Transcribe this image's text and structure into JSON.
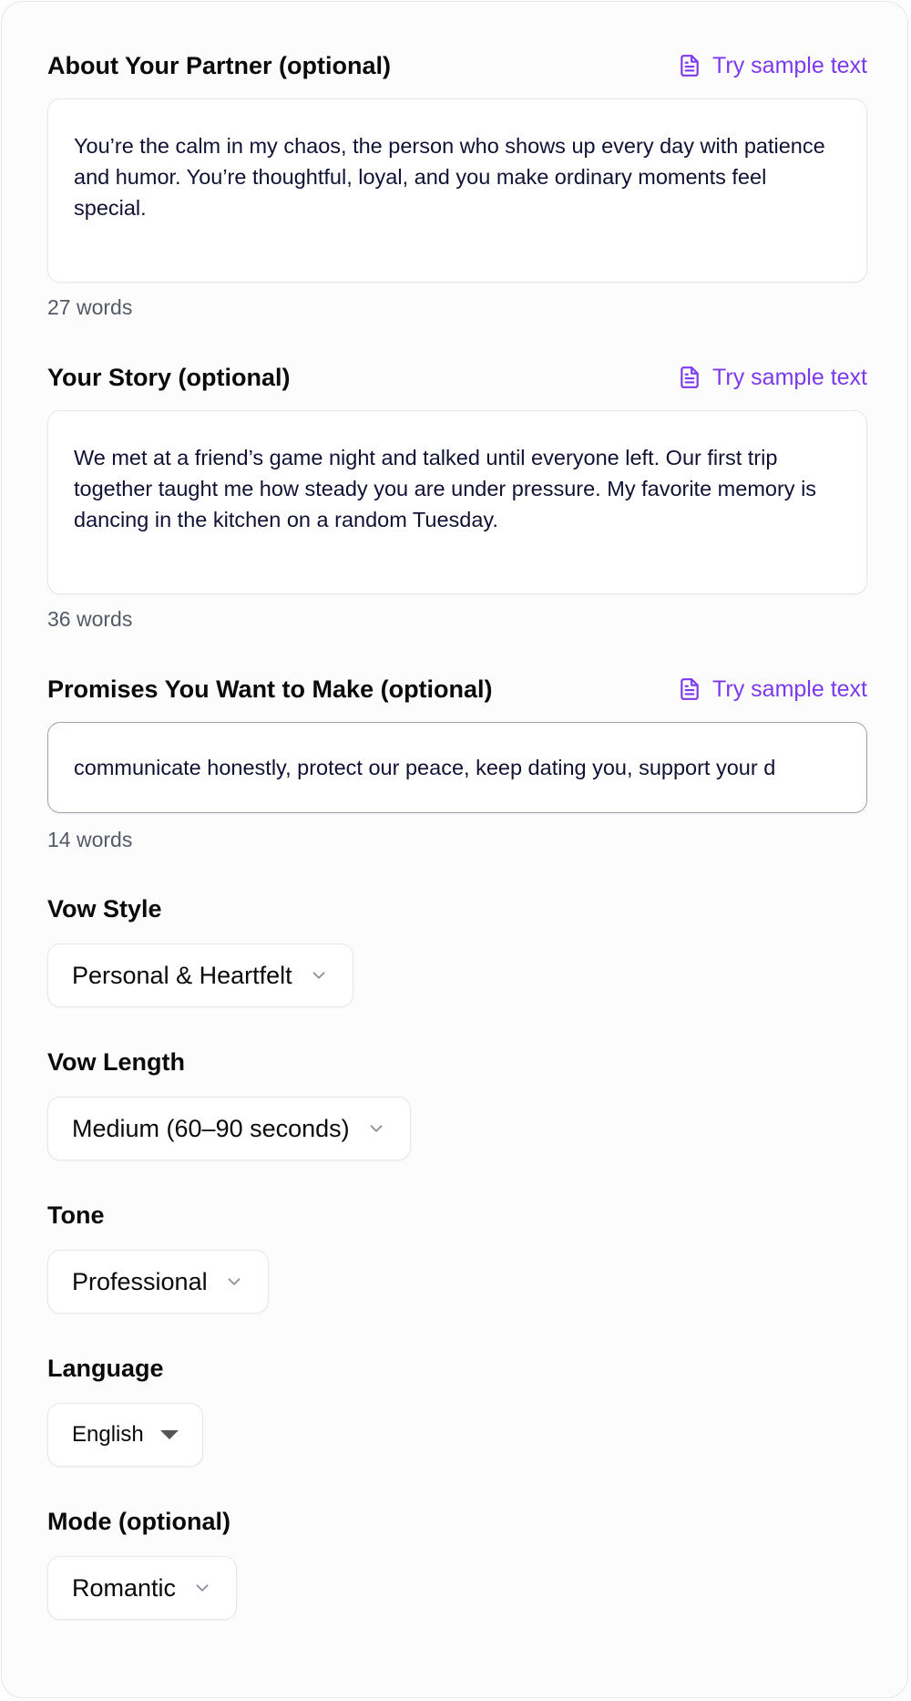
{
  "sample_link_label": "Try sample text",
  "accent_color": "#7c3aed",
  "partner": {
    "label": "About Your Partner (optional)",
    "value": "You’re the calm in my chaos, the person who shows up every day with patience and humor. You’re thoughtful, loyal, and you make ordinary moments feel special.",
    "word_count": "27 words"
  },
  "story": {
    "label": "Your Story (optional)",
    "value": "We met at a friend’s game night and talked until everyone left. Our first trip together taught me how steady you are under pressure. My favorite memory is dancing in the kitchen on a random Tuesday.",
    "word_count": "36 words"
  },
  "promises": {
    "label": "Promises You Want to Make (optional)",
    "value": "communicate honestly, protect our peace, keep dating you, support your d",
    "word_count": "14 words"
  },
  "vow_style": {
    "label": "Vow Style",
    "value": "Personal & Heartfelt"
  },
  "vow_length": {
    "label": "Vow Length",
    "value": "Medium (60–90 seconds)"
  },
  "tone": {
    "label": "Tone",
    "value": "Professional"
  },
  "language": {
    "label": "Language",
    "value": "English"
  },
  "mode": {
    "label": "Mode (optional)",
    "value": "Romantic"
  },
  "icons": {
    "sample": "document-icon",
    "dropdown": "chevron-down-icon",
    "native_dropdown": "caret-down-icon"
  }
}
